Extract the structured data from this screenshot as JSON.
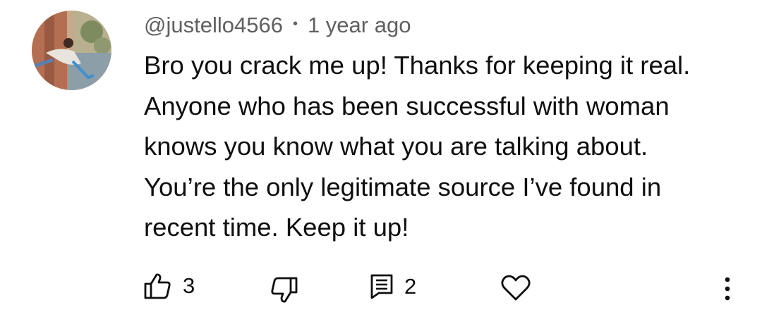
{
  "comment": {
    "author": "@justello4566",
    "separator": "•",
    "timestamp": "1 year ago",
    "text": "Bro you crack me up! Thanks for keeping it real.\nAnyone who has been successful with woman\nknows you know what you are talking about.\nYou’re the only legitimate source I’ve found in\nrecent time. Keep it up!"
  },
  "actions": {
    "like_count": "3",
    "reply_count": "2",
    "icons": {
      "like": "thumbs-up-icon",
      "dislike": "thumbs-down-icon",
      "replies": "comment-icon",
      "heart": "heart-icon",
      "menu": "more-vertical-icon"
    }
  },
  "colors": {
    "text": "#0f0f0f",
    "secondary_text": "#606060",
    "background": "#ffffff"
  }
}
